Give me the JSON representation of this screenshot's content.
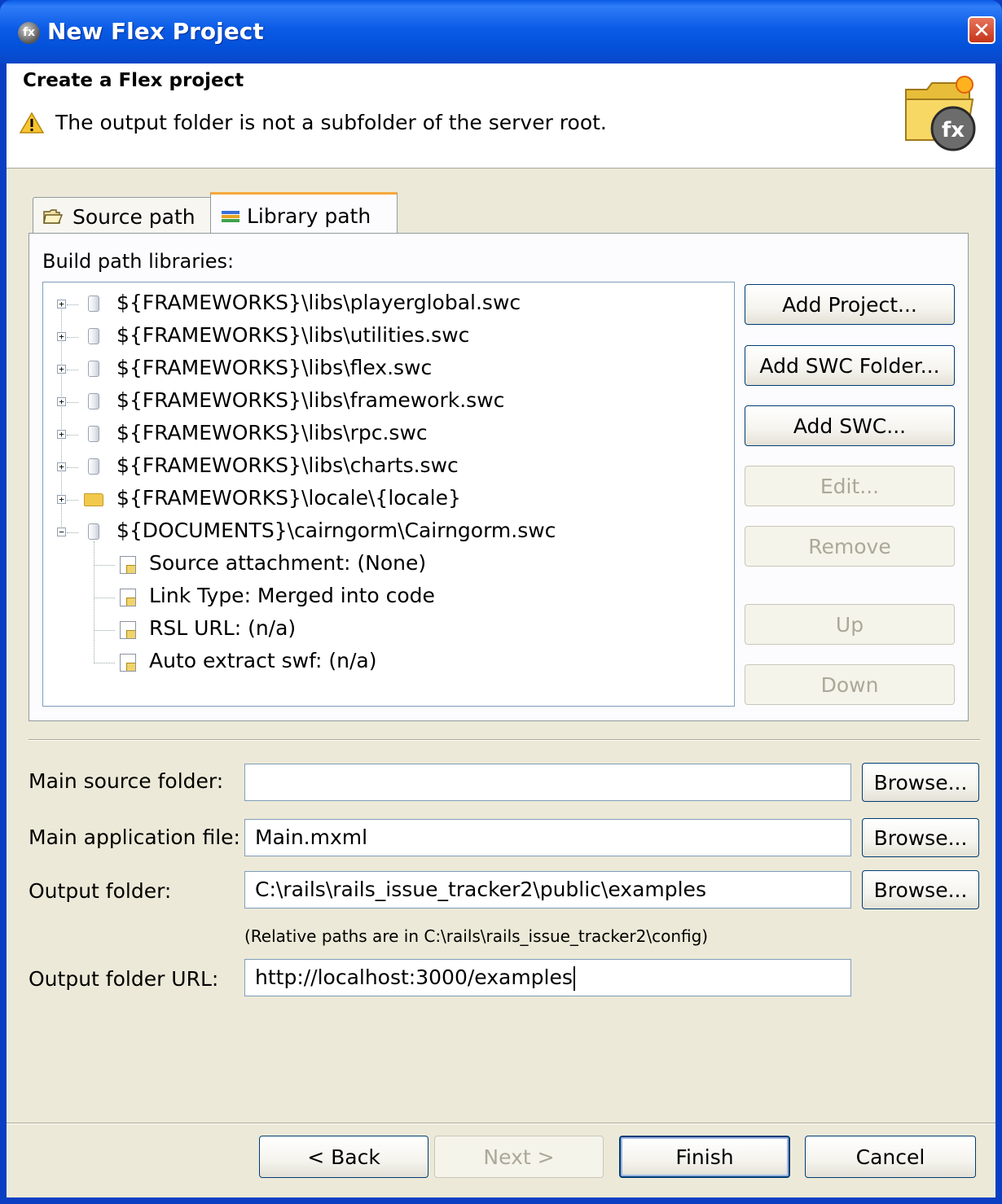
{
  "window": {
    "title": "New Flex Project",
    "close_glyph": "✕"
  },
  "header": {
    "title": "Create a Flex project",
    "message": "The output folder is not a subfolder of the server root.",
    "warning_icon": "warning-triangle-icon",
    "wizard_icon": "flex-project-folder-icon"
  },
  "tabs": [
    {
      "label": "Source path",
      "icon": "open-folder-icon",
      "selected": false
    },
    {
      "label": "Library path",
      "icon": "library-books-icon",
      "selected": true
    }
  ],
  "library_panel": {
    "label": "Build path libraries:",
    "tree": [
      {
        "text": "${FRAMEWORKS}\\libs\\playerglobal.swc",
        "icon": "jar-icon",
        "expander": "+"
      },
      {
        "text": "${FRAMEWORKS}\\libs\\utilities.swc",
        "icon": "jar-icon",
        "expander": "+"
      },
      {
        "text": "${FRAMEWORKS}\\libs\\flex.swc",
        "icon": "jar-icon",
        "expander": "+"
      },
      {
        "text": "${FRAMEWORKS}\\libs\\framework.swc",
        "icon": "jar-icon",
        "expander": "+"
      },
      {
        "text": "${FRAMEWORKS}\\libs\\rpc.swc",
        "icon": "jar-icon",
        "expander": "+"
      },
      {
        "text": "${FRAMEWORKS}\\libs\\charts.swc",
        "icon": "jar-icon",
        "expander": "+"
      },
      {
        "text": "${FRAMEWORKS}\\locale\\{locale}",
        "icon": "folder-icon",
        "expander": "+"
      },
      {
        "text": "${DOCUMENTS}\\cairngorm\\Cairngorm.swc",
        "icon": "jar-icon",
        "expander": "-"
      }
    ],
    "attributes": [
      "Source attachment: (None)",
      "Link Type: Merged into code",
      "RSL URL: (n/a)",
      "Auto extract swf: (n/a)"
    ],
    "buttons": {
      "add_project": "Add Project...",
      "add_swc_folder": "Add SWC Folder...",
      "add_swc": "Add SWC...",
      "edit": "Edit...",
      "remove": "Remove",
      "up": "Up",
      "down": "Down"
    }
  },
  "form": {
    "main_source_folder": {
      "label": "Main source folder:",
      "value": ""
    },
    "main_application_file": {
      "label": "Main application file:",
      "value": "Main.mxml"
    },
    "output_folder": {
      "label": "Output folder:",
      "value": "C:\\rails\\rails_issue_tracker2\\public\\examples"
    },
    "relative_note": "(Relative paths are in C:\\rails\\rails_issue_tracker2\\config)",
    "output_folder_url": {
      "label": "Output folder URL:",
      "value": "http://localhost:3000/examples"
    },
    "browse_label": "Browse..."
  },
  "footer": {
    "back": "< Back",
    "next": "Next >",
    "finish": "Finish",
    "cancel": "Cancel"
  },
  "colors": {
    "titlebar": "#0a5ae6",
    "dialog_bg": "#ece9d8",
    "tab_accent": "#f7a83b"
  }
}
